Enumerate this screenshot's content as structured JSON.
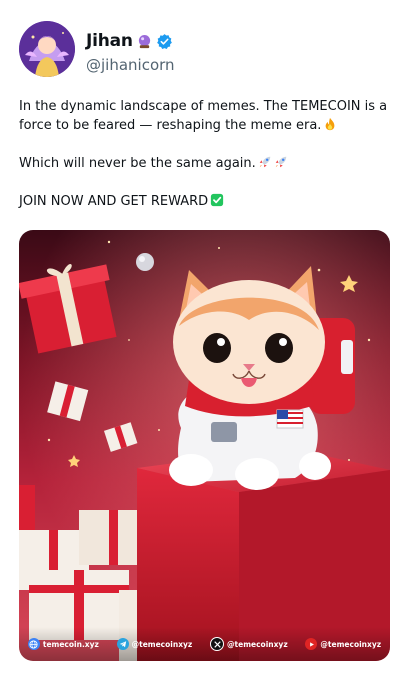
{
  "author": {
    "display_name": "Jihan",
    "handle": "@jihanicorn",
    "verified": true,
    "name_emoji": "crystal-ball-icon"
  },
  "tweet": {
    "line1": "In the dynamic landscape of memes. The TEMECOIN is a force to be feared — reshaping  the meme era.",
    "line2": "Which will never be the same again.",
    "line3": "JOIN NOW AND GET REWARD",
    "emojis": [
      "fire-icon",
      "rocket-icon",
      "rocket-icon",
      "check-mark-icon"
    ]
  },
  "media": {
    "socials": [
      {
        "icon": "globe-icon",
        "label": "temecoin.xyz",
        "color": "#3b82f6"
      },
      {
        "icon": "telegram-icon",
        "label": "@temecoinxyz",
        "color": "#2aa3de"
      },
      {
        "icon": "x-icon",
        "label": "@temecoinxyz",
        "color": "#111111"
      },
      {
        "icon": "youtube-icon",
        "label": "@temecoinxyz",
        "color": "#e02424"
      }
    ]
  }
}
